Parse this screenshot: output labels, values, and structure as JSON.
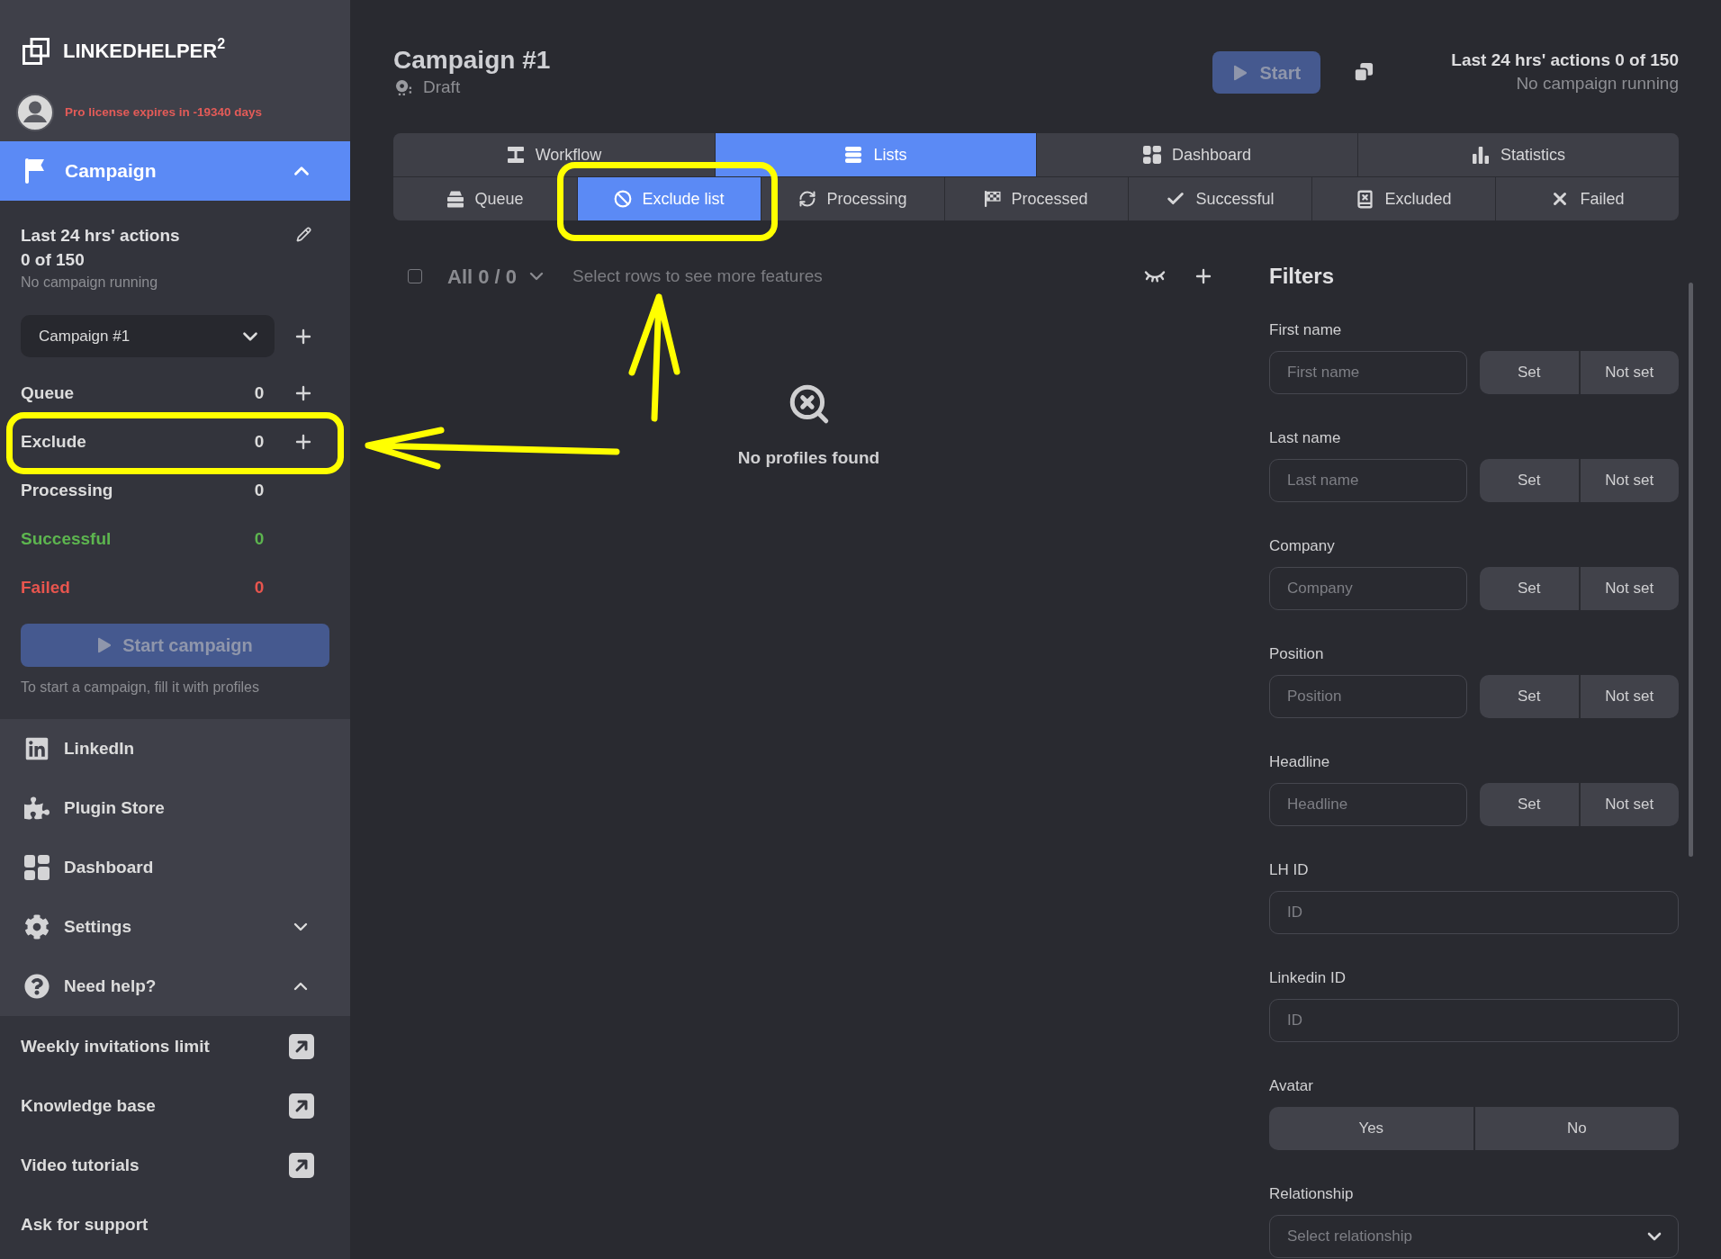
{
  "sidebar": {
    "logo": "LINKEDHELPER$^{2}$",
    "license_notice": "Pro license expires in -19340 days",
    "campaign_section": {
      "title": "Campaign",
      "active": true,
      "expanded": true
    },
    "actions_summary": {
      "title": "Last 24 hrs' actions",
      "count": "0 of 150",
      "status": "No campaign running"
    },
    "campaign_select": {
      "value": "Campaign #1"
    },
    "lists": [
      {
        "label": "Queue",
        "count": "0",
        "color": "#dcdcdc",
        "can_add": true
      },
      {
        "label": "Exclude",
        "count": "0",
        "color": "#dcdcdc",
        "can_add": true
      },
      {
        "label": "Processing",
        "count": "0",
        "color": "#dcdcdc",
        "can_add": false
      },
      {
        "label": "Successful",
        "count": "0",
        "color": "#5db54f",
        "can_add": false
      },
      {
        "label": "Failed",
        "count": "0",
        "color": "#e8554e",
        "can_add": false
      }
    ],
    "start_button": {
      "label": "Start campaign",
      "disabled": true
    },
    "start_hint": "To start a campaign, fill it with profiles",
    "nav_items": [
      {
        "kind": "link",
        "label": "LinkedIn"
      },
      {
        "kind": "link",
        "label": "Plugin Store"
      },
      {
        "kind": "link",
        "label": "Dashboard"
      },
      {
        "kind": "group",
        "label": "Settings",
        "expanded": false
      },
      {
        "kind": "group",
        "label": "Need help?",
        "expanded": true
      }
    ],
    "help_links": [
      {
        "label": "Weekly invitations limit",
        "external": true
      },
      {
        "label": "Knowledge base",
        "external": true
      },
      {
        "label": "Video tutorials",
        "external": true
      },
      {
        "label": "Ask for support",
        "external": false
      }
    ]
  },
  "header": {
    "title": "Campaign #1",
    "status": "Draft",
    "start_button": {
      "label": "Start",
      "disabled": true
    },
    "actions_summary": "Last 24 hrs' actions 0 of 150",
    "running_status": "No campaign running"
  },
  "main_tabs": [
    {
      "label": "Workflow",
      "selected": false
    },
    {
      "label": "Lists",
      "selected": true
    },
    {
      "label": "Dashboard",
      "selected": false
    },
    {
      "label": "Statistics",
      "selected": false
    }
  ],
  "list_tabs": [
    {
      "label": "Queue",
      "selected": false
    },
    {
      "label": "Exclude list",
      "selected": true
    },
    {
      "label": "Processing",
      "selected": false
    },
    {
      "label": "Processed",
      "selected": false
    },
    {
      "label": "Successful",
      "selected": false
    },
    {
      "label": "Excluded",
      "selected": false
    },
    {
      "label": "Failed",
      "selected": false
    }
  ],
  "table_toolbar": {
    "select_all_checked": false,
    "count_label": "All 0 / 0",
    "hint": "Select rows to see more features"
  },
  "empty_state": {
    "message": "No profiles found"
  },
  "filters": {
    "title": "Filters",
    "fields": [
      {
        "kind": "text_presence",
        "label": "First name",
        "placeholder": "First name",
        "options": [
          {
            "label": "Set",
            "selected": false
          },
          {
            "label": "Not set",
            "selected": false
          }
        ]
      },
      {
        "kind": "text_presence",
        "label": "Last name",
        "placeholder": "Last name",
        "options": [
          {
            "label": "Set",
            "selected": false
          },
          {
            "label": "Not set",
            "selected": false
          }
        ]
      },
      {
        "kind": "text_presence",
        "label": "Company",
        "placeholder": "Company",
        "options": [
          {
            "label": "Set",
            "selected": false
          },
          {
            "label": "Not set",
            "selected": false
          }
        ]
      },
      {
        "kind": "text_presence",
        "label": "Position",
        "placeholder": "Position",
        "options": [
          {
            "label": "Set",
            "selected": false
          },
          {
            "label": "Not set",
            "selected": false
          }
        ]
      },
      {
        "kind": "text_presence",
        "label": "Headline",
        "placeholder": "Headline",
        "options": [
          {
            "label": "Set",
            "selected": false
          },
          {
            "label": "Not set",
            "selected": false
          }
        ]
      },
      {
        "kind": "text",
        "label": "LH ID",
        "placeholder": "ID"
      },
      {
        "kind": "text",
        "label": "Linkedin ID",
        "placeholder": "ID"
      },
      {
        "kind": "choice",
        "label": "Avatar",
        "options": [
          {
            "label": "Yes",
            "selected": false
          },
          {
            "label": "No",
            "selected": false
          }
        ]
      },
      {
        "kind": "select",
        "label": "Relationship",
        "placeholder": "Select relationship"
      }
    ]
  }
}
